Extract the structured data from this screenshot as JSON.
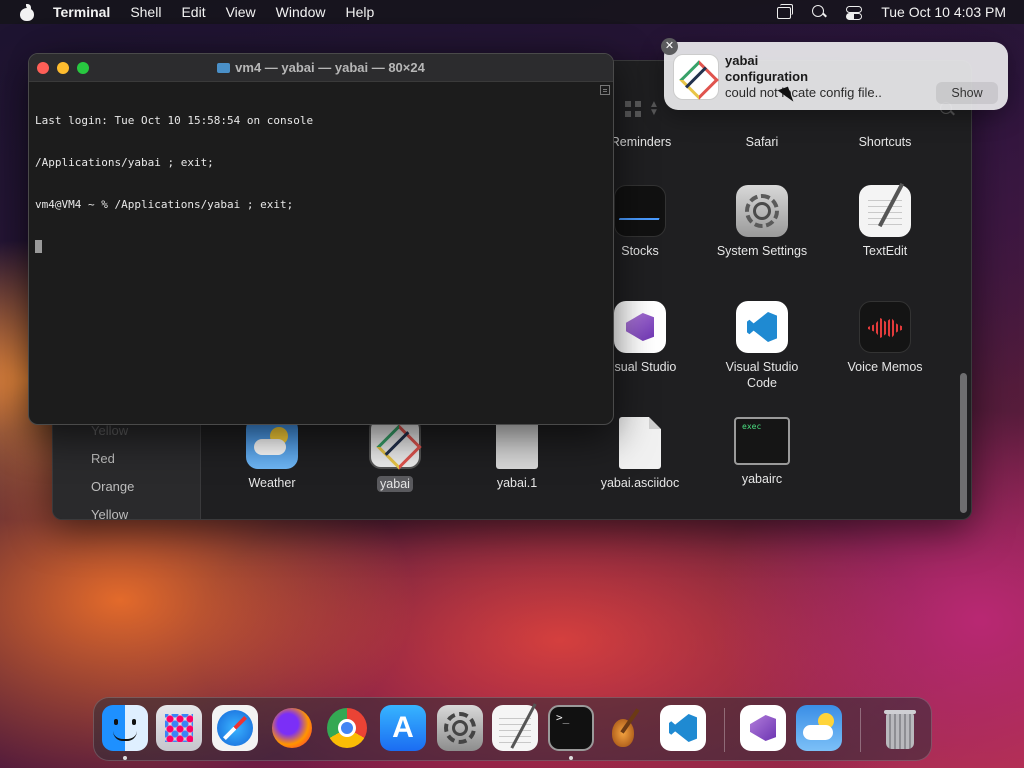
{
  "menubar": {
    "app_name": "Terminal",
    "menus": [
      "Shell",
      "Edit",
      "View",
      "Window",
      "Help"
    ],
    "clock": "Tue Oct 10  4:03 PM",
    "status_icons": [
      "screen-mirroring-icon",
      "search-icon",
      "control-center-icon"
    ]
  },
  "terminal": {
    "title": "vm4 — yabai — yabai — 80×24",
    "lines": [
      "Last login: Tue Oct 10 15:58:54 on console",
      "/Applications/yabai ; exit;",
      "vm4@VM4 ~ % /Applications/yabai ; exit;"
    ]
  },
  "notification": {
    "app": "yabai",
    "subtitle": "configuration",
    "body": "could not locate config file..",
    "action": "Show",
    "close_glyph": "✕"
  },
  "finder": {
    "sidebar_tags": [
      "Yellow",
      "Red",
      "Orange",
      "Yellow"
    ],
    "sidebar_tag_colors": [
      "#b59a36",
      "#d9534f",
      "#e8903a",
      "#d8c447"
    ],
    "sidebar_tag_first_label": "Yellow",
    "items": {
      "reminders": "Reminders",
      "safari": "Safari",
      "shortcuts": "Shortcuts",
      "stocks": "Stocks",
      "system_settings": "System Settings",
      "textedit": "TextEdit",
      "visual_studio": "Visual Studio",
      "vscode_line1": "Visual Studio",
      "vscode_line2": "Code",
      "voice_memos": "Voice Memos",
      "weather": "Weather",
      "yabai": "yabai",
      "yabai_1": "yabai.1",
      "yabai_asciidoc": "yabai.asciidoc",
      "yabairc": "yabairc",
      "exec_label": "exec"
    }
  },
  "dock": {
    "apps": [
      "Finder",
      "Launchpad",
      "Safari",
      "Firefox",
      "Google Chrome",
      "App Store",
      "System Settings",
      "TextEdit",
      "Terminal",
      "GarageBand",
      "Visual Studio Code",
      "Visual Studio",
      "Weather",
      "Trash"
    ],
    "terminal_glyph": ">_"
  }
}
